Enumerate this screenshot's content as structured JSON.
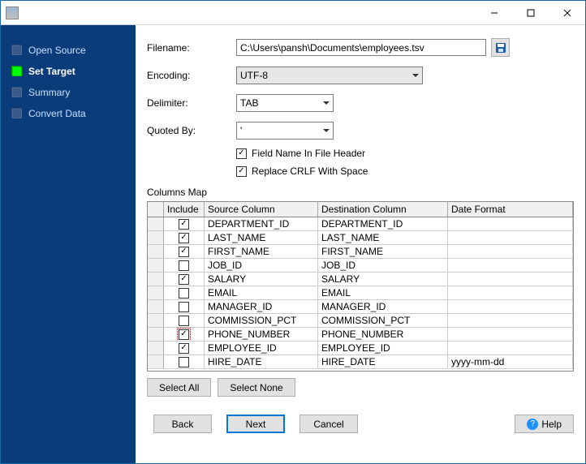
{
  "titlebar": {
    "title": ""
  },
  "nav": {
    "items": [
      {
        "label": "Open Source",
        "active": false,
        "green": false
      },
      {
        "label": "Set Target",
        "active": true,
        "green": true
      },
      {
        "label": "Summary",
        "active": false,
        "green": false
      },
      {
        "label": "Convert Data",
        "active": false,
        "green": false
      }
    ]
  },
  "form": {
    "filename_label": "Filename:",
    "filename_value": "C:\\Users\\pansh\\Documents\\employees.tsv",
    "encoding_label": "Encoding:",
    "encoding_value": "UTF-8",
    "delimiter_label": "Delimiter:",
    "delimiter_value": "TAB",
    "quoted_label": "Quoted By:",
    "quoted_value": "'",
    "header_checkbox_label": "Field Name In File Header",
    "header_checked": true,
    "crlf_checkbox_label": "Replace CRLF With Space",
    "crlf_checked": true
  },
  "columns_map": {
    "title": "Columns Map",
    "headers": {
      "include": "Include",
      "source": "Source Column",
      "dest": "Destination Column",
      "datef": "Date Format"
    },
    "rows": [
      {
        "include": true,
        "source": "DEPARTMENT_ID",
        "dest": "DEPARTMENT_ID",
        "datef": "",
        "dotted": false
      },
      {
        "include": true,
        "source": "LAST_NAME",
        "dest": "LAST_NAME",
        "datef": "",
        "dotted": false
      },
      {
        "include": true,
        "source": "FIRST_NAME",
        "dest": "FIRST_NAME",
        "datef": "",
        "dotted": false
      },
      {
        "include": false,
        "source": "JOB_ID",
        "dest": "JOB_ID",
        "datef": "",
        "dotted": false
      },
      {
        "include": true,
        "source": "SALARY",
        "dest": "SALARY",
        "datef": "",
        "dotted": false
      },
      {
        "include": false,
        "source": "EMAIL",
        "dest": "EMAIL",
        "datef": "",
        "dotted": false
      },
      {
        "include": false,
        "source": "MANAGER_ID",
        "dest": "MANAGER_ID",
        "datef": "",
        "dotted": false
      },
      {
        "include": false,
        "source": "COMMISSION_PCT",
        "dest": "COMMISSION_PCT",
        "datef": "",
        "dotted": false
      },
      {
        "include": true,
        "source": "PHONE_NUMBER",
        "dest": "PHONE_NUMBER",
        "datef": "",
        "dotted": true
      },
      {
        "include": true,
        "source": "EMPLOYEE_ID",
        "dest": "EMPLOYEE_ID",
        "datef": "",
        "dotted": false
      },
      {
        "include": false,
        "source": "HIRE_DATE",
        "dest": "HIRE_DATE",
        "datef": "yyyy-mm-dd",
        "dotted": false
      }
    ]
  },
  "buttons": {
    "select_all": "Select All",
    "select_none": "Select None",
    "back": "Back",
    "next": "Next",
    "cancel": "Cancel",
    "help": "Help"
  }
}
